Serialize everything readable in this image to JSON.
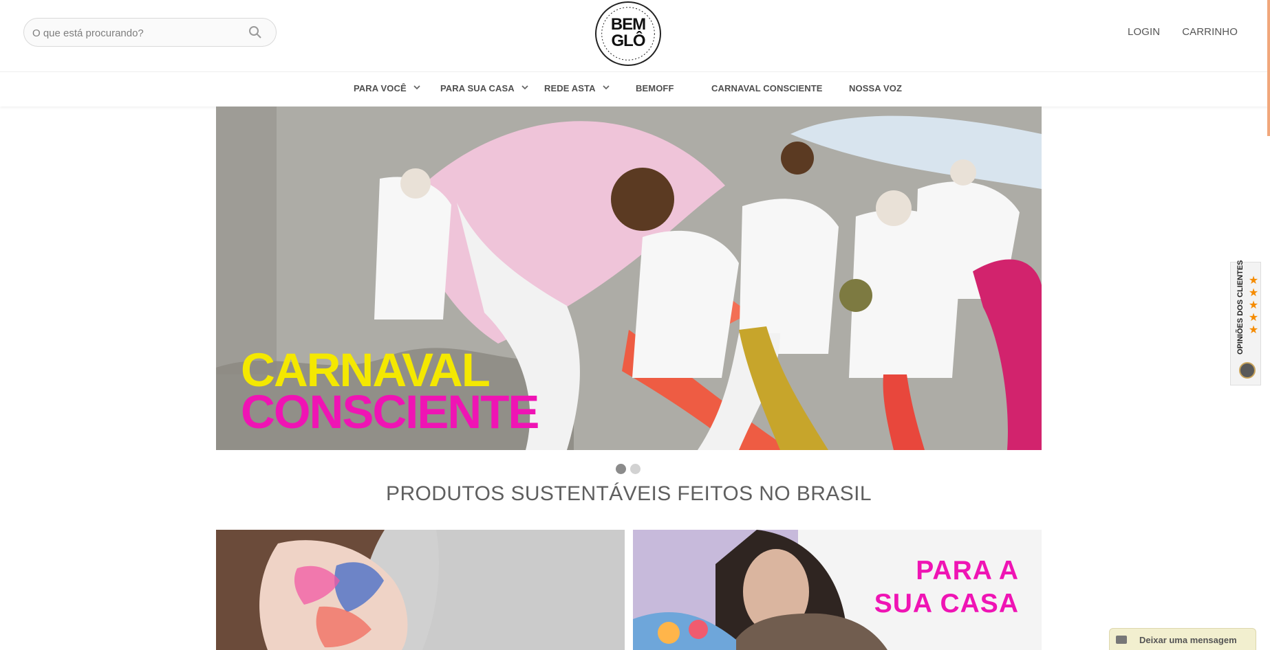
{
  "search": {
    "placeholder": "O que está procurando?"
  },
  "header": {
    "logo_line1": "BEM",
    "logo_line2": "GLÔ",
    "login": "LOGIN",
    "cart": "CARRINHO"
  },
  "nav": {
    "items": [
      {
        "label": "PARA VOCÊ"
      },
      {
        "label": "PARA SUA CASA"
      },
      {
        "label": "REDE ASTA"
      },
      {
        "label": "BEMOFF"
      },
      {
        "label": "CARNAVAL CONSCIENTE"
      },
      {
        "label": "NOSSA VOZ"
      }
    ]
  },
  "hero": {
    "line1": "CARNAVAL",
    "line2": "CONSCIENTE",
    "colors": {
      "line1": "#f4e800",
      "line2": "#ef14b4"
    }
  },
  "slider": {
    "total": 2,
    "active": 1
  },
  "section": {
    "title": "PRODUTOS SUSTENTÁVEIS FEITOS NO BRASIL"
  },
  "cards": {
    "right_line1": "PARA A",
    "right_line2": "SUA CASA"
  },
  "reviews": {
    "label": "OPINIÕES DOS CLIENTES",
    "rating": 5
  },
  "chat": {
    "label": "Deixar uma mensagem",
    "icon": "mail-icon"
  }
}
